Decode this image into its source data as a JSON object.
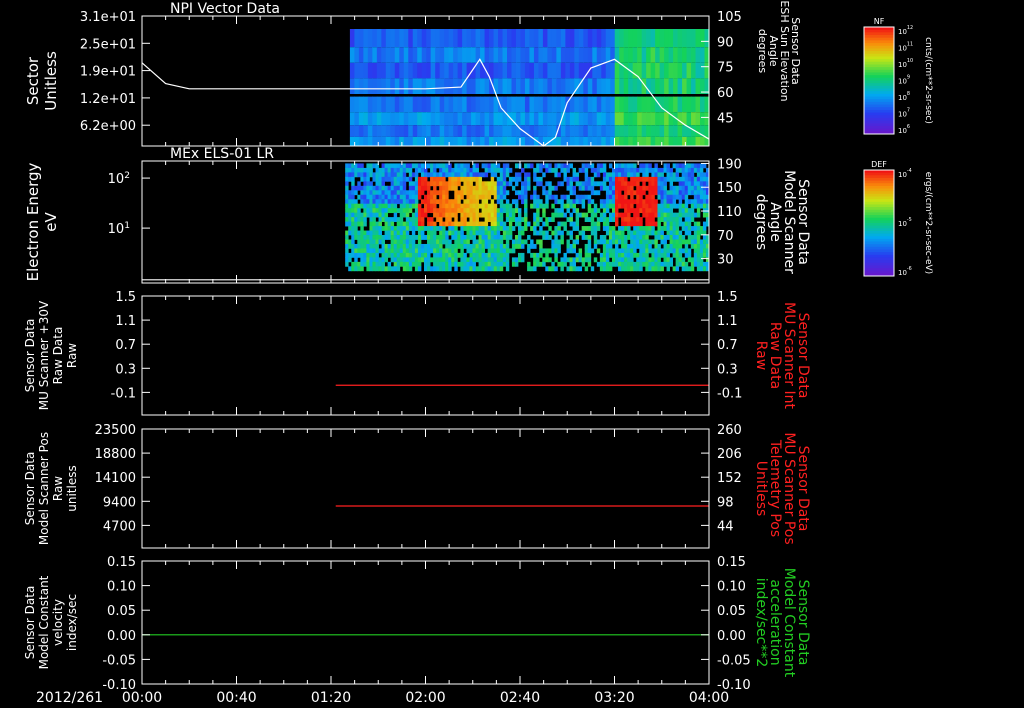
{
  "date_label": "2012/261",
  "time_ticks": [
    "00:00",
    "00:40",
    "01:20",
    "02:00",
    "02:40",
    "03:20",
    "04:00"
  ],
  "colors": {
    "background": "#000000",
    "axes": "#ffffff",
    "red": "#ff2020",
    "green": "#22cc22"
  },
  "colorbars": [
    {
      "label": "NF",
      "units": "cnts/(cm**2-sr-sec)",
      "ticks": [
        "10^12",
        "10^11",
        "10^10",
        "10^9",
        "10^8",
        "10^7",
        "10^6"
      ]
    },
    {
      "label": "DEF",
      "units": "ergs/(cm**2-sr-sec-eV)",
      "ticks": [
        "10^-4",
        "10^-5",
        "10^-6"
      ]
    }
  ],
  "chart_data": [
    {
      "type": "heatmap",
      "title": "NPI Vector Data",
      "ylabel": [
        "Sector",
        "Unitless"
      ],
      "y_ticks": [
        "3.1e+01",
        "2.5e+01",
        "1.9e+01",
        "1.2e+01",
        "6.2e+00"
      ],
      "y2_label": [
        "Sensor Data",
        "ESH Sun Elevation",
        "Angle",
        "degrees"
      ],
      "y2_ticks": [
        "105",
        "90",
        "75",
        "60",
        "45"
      ],
      "x_range_minutes": [
        0,
        240
      ],
      "data_start_minutes": 88,
      "overlay_line": {
        "x": [
          0,
          10,
          20,
          40,
          60,
          80,
          100,
          120,
          135,
          140,
          143,
          147,
          152,
          160,
          170,
          175,
          180,
          190,
          200,
          210,
          220,
          230,
          240
        ],
        "y": [
          78,
          66,
          63,
          63,
          63,
          63,
          63,
          63,
          64,
          74,
          80,
          70,
          52,
          40,
          30,
          35,
          55,
          75,
          80,
          70,
          52,
          42,
          34
        ]
      }
    },
    {
      "type": "heatmap",
      "title": "MEx ELS-01 LR",
      "ylabel": [
        "Electron Energy",
        "eV"
      ],
      "y_ticks": [
        "10^2",
        "10^1"
      ],
      "y2_label": [
        "Sensor Data",
        "Model Scanner",
        "Angle",
        "degrees"
      ],
      "y2_ticks": [
        "190",
        "150",
        "110",
        "70",
        "30"
      ],
      "x_range_minutes": [
        0,
        240
      ],
      "data_start_minutes": 86,
      "overlay_line": {
        "x": [
          0,
          240
        ],
        "y": [
          5,
          5
        ]
      }
    },
    {
      "type": "line",
      "ylabel": [
        "Sensor Data",
        "MU Scanner +30V",
        "Raw Data",
        "Raw"
      ],
      "y_ticks": [
        "1.5",
        "1.1",
        "0.7",
        "0.3",
        "-0.1"
      ],
      "y2_label": [
        "Sensor Data",
        "MU Scanner Int",
        "Raw Data",
        "Raw"
      ],
      "y2_ticks": [
        "1.5",
        "1.1",
        "0.7",
        "0.3",
        "-0.1"
      ],
      "ylim": [
        -0.5,
        1.5
      ],
      "series": [
        {
          "color": "#ff2020",
          "x": [
            82,
            240
          ],
          "y": [
            0.0,
            0.0
          ]
        }
      ]
    },
    {
      "type": "line",
      "ylabel": [
        "Sensor Data",
        "Model Scanner Pos",
        "Raw",
        "unitless"
      ],
      "y_ticks": [
        "23500",
        "18800",
        "14100",
        "9400",
        "4700"
      ],
      "y2_label": [
        "Sensor Data",
        "MU Scanner Pos",
        "Telemetry Pos",
        "Unitless"
      ],
      "y2_ticks": [
        "260",
        "206",
        "152",
        "98",
        "44"
      ],
      "ylim": [
        0,
        23500
      ],
      "series": [
        {
          "color": "#ff2020",
          "x": [
            82,
            240
          ],
          "y": [
            8300,
            8300
          ]
        }
      ]
    },
    {
      "type": "line",
      "ylabel": [
        "Sensor Data",
        "Model Constant",
        "velocity",
        "index/sec"
      ],
      "y_ticks": [
        "0.15",
        "0.10",
        "0.05",
        "0.00",
        "-0.05",
        "-0.10"
      ],
      "y2_label": [
        "Sensor Data",
        "Model Constant",
        "acceleration",
        "index/sec**2"
      ],
      "y2_ticks": [
        "0.15",
        "0.10",
        "0.05",
        "0.00",
        "-0.05",
        "-0.10"
      ],
      "ylim": [
        -0.1,
        0.15
      ],
      "series": [
        {
          "color": "#22cc22",
          "x": [
            0,
            240
          ],
          "y": [
            0.0,
            0.0
          ]
        }
      ]
    }
  ]
}
